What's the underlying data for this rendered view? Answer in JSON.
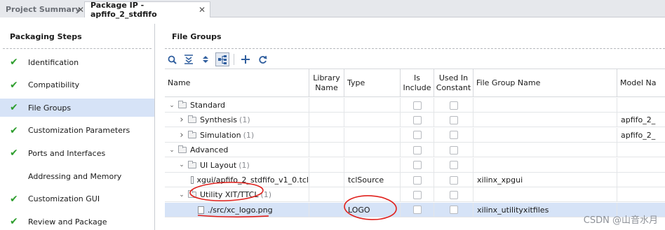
{
  "tabs": [
    {
      "label": "Project Summary",
      "active": false
    },
    {
      "label": "Package IP - apfifo_2_stdfifo",
      "active": true
    }
  ],
  "left": {
    "title": "Packaging Steps",
    "steps": [
      {
        "label": "Identification",
        "done": true
      },
      {
        "label": "Compatibility",
        "done": true
      },
      {
        "label": "File Groups",
        "done": true,
        "selected": true
      },
      {
        "label": "Customization Parameters",
        "done": true
      },
      {
        "label": "Ports and Interfaces",
        "done": true
      },
      {
        "label": "Addressing and Memory",
        "done": false
      },
      {
        "label": "Customization GUI",
        "done": true
      },
      {
        "label": "Review and Package",
        "done": true
      }
    ]
  },
  "right": {
    "title": "File Groups",
    "toolbar": [
      "search-icon",
      "collapse-all-icon",
      "expand-all-icon",
      "hierarchy-icon",
      "add-icon",
      "refresh-icon"
    ],
    "columns": {
      "name": "Name",
      "library_name": "Library\nName",
      "type": "Type",
      "is_include": "Is\nInclude",
      "used_in_constant": "Used In\nConstant",
      "file_group_name": "File Group Name",
      "model_name": "Model Na"
    },
    "rows": [
      {
        "name": "Standard",
        "count": "",
        "kind": "folder",
        "expander": "open",
        "type": "",
        "file_group_name": "",
        "model_name": ""
      },
      {
        "name": "Synthesis",
        "count": "(1)",
        "kind": "folder",
        "expander": "closed",
        "type": "",
        "file_group_name": "",
        "model_name": "apfifo_2_"
      },
      {
        "name": "Simulation",
        "count": "(1)",
        "kind": "folder",
        "expander": "closed",
        "type": "",
        "file_group_name": "",
        "model_name": "apfifo_2_"
      },
      {
        "name": "Advanced",
        "count": "",
        "kind": "folder",
        "expander": "open",
        "type": "",
        "file_group_name": "",
        "model_name": ""
      },
      {
        "name": "UI Layout",
        "count": "(1)",
        "kind": "folder",
        "expander": "open",
        "type": "",
        "file_group_name": "",
        "model_name": ""
      },
      {
        "name": "xgui/apfifo_2_stdfifo_v1_0.tcl",
        "count": "",
        "kind": "file",
        "expander": "",
        "type": "tclSource",
        "file_group_name": "xilinx_xpgui",
        "model_name": ""
      },
      {
        "name": "Utility XIT/TTCL",
        "count": "(1)",
        "kind": "folder",
        "expander": "open",
        "type": "",
        "file_group_name": "",
        "model_name": ""
      },
      {
        "name": "./src/xc_logo.png",
        "count": "",
        "kind": "file",
        "expander": "",
        "type": "LOGO",
        "file_group_name": "xilinx_utilityxitfiles",
        "model_name": "",
        "selected": true
      }
    ],
    "annotation_color": "#e0201c"
  },
  "watermark": "CSDN @山音水月"
}
